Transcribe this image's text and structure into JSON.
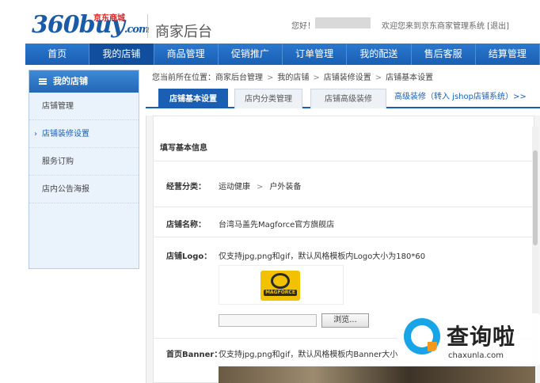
{
  "header": {
    "logo_main": "360buy",
    "logo_suffix": ".com",
    "logo_tag": "京东商城",
    "portal_title": "商家后台",
    "greeting": "您好！",
    "welcome": "欢迎您来到京东商家管理系统 [退出]"
  },
  "nav": {
    "items": [
      "首页",
      "我的店铺",
      "商品管理",
      "促销推广",
      "订单管理",
      "我的配送",
      "售后客服",
      "结算管理"
    ],
    "active": "我的店铺"
  },
  "sidebar": {
    "title": "我的店铺",
    "items": [
      "店铺管理",
      "店铺装修设置",
      "服务订购",
      "店内公告海报"
    ],
    "active": "店铺装修设置"
  },
  "breadcrumb": {
    "prefix": "您当前所在位置：",
    "items": [
      "商家后台管理",
      "我的店铺",
      "店铺装修设置",
      "店铺基本设置"
    ]
  },
  "tabs": {
    "items": [
      "店铺基本设置",
      "店内分类管理",
      "店铺高级装修"
    ],
    "active": "店铺基本设置",
    "advanced_link": "高级装修（转入 jshop店铺系统）>>"
  },
  "form": {
    "section_title": "填写基本信息",
    "category": {
      "label": "经营分类：",
      "values": [
        "运动健康",
        "户外装备"
      ]
    },
    "shop_name": {
      "label": "店铺名称：",
      "value": "台湾马盖先Magforce官方旗舰店"
    },
    "shop_logo": {
      "label": "店铺Logo：",
      "hint": "仅支持jpg,png和gif，默认风格模板内Logo大小为180*60",
      "preview_text": "MAGFORCE",
      "browse_label": "浏览..."
    },
    "banner": {
      "label": "首页Banner：",
      "hint": "仅支持jpg,png和gif，默认风格模板内Banner大小"
    }
  },
  "watermark": {
    "text": "查询啦",
    "url": "chaxunla.com"
  },
  "colors": {
    "brand_blue": "#1a5fb4",
    "logo_red": "#d8262c"
  }
}
